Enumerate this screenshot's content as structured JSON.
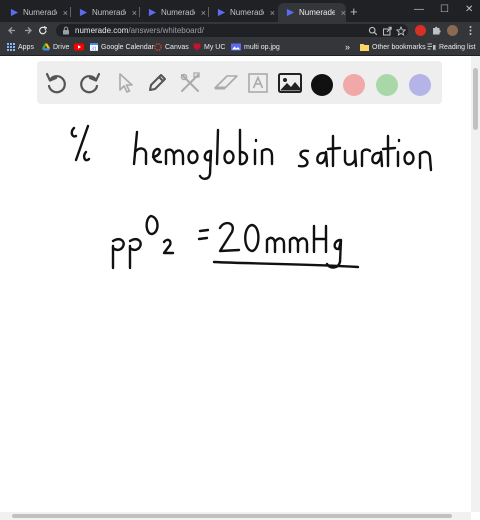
{
  "tabs": [
    {
      "title": "Numerade W"
    },
    {
      "title": "Numerade W"
    },
    {
      "title": "Numerade W"
    },
    {
      "title": "Numerade W"
    },
    {
      "title": "Numerade W",
      "active": true
    }
  ],
  "tab_close_glyph": "×",
  "new_tab_glyph": "+",
  "window_controls": {
    "minimize": "—",
    "maximize": "☐",
    "close": "✕"
  },
  "address": {
    "host": "numerade.com",
    "path": "/answers/whiteboard/"
  },
  "bookmarks": [
    {
      "label": "Apps",
      "icon": "apps-grid-icon"
    },
    {
      "label": "Drive",
      "icon": "google-drive-icon"
    },
    {
      "label": "",
      "icon": "youtube-icon"
    },
    {
      "label": "Google Calendar",
      "icon": "google-calendar-icon"
    },
    {
      "label": "Canvas",
      "icon": "canvas-icon"
    },
    {
      "label": "My UC",
      "icon": "my-uc-icon"
    },
    {
      "label": "multi op.jpg",
      "icon": "image-file-icon"
    }
  ],
  "bookmarks_overflow": "»",
  "other_bookmarks": "Other bookmarks",
  "reading_list": "Reading list",
  "whiteboard": {
    "tools": [
      "undo-icon",
      "redo-icon",
      "pointer-icon",
      "pen-icon",
      "tools-icon",
      "eraser-icon",
      "text-icon",
      "image-icon"
    ],
    "colors": [
      "#111111",
      "#f0a8a8",
      "#a9d8a8",
      "#b4b4e8"
    ],
    "handwriting": [
      "% hemoglobin saturation",
      "ppO2 = 20mmHg"
    ]
  },
  "colors": {
    "chrome_dark": "#202124",
    "chrome_mid": "#35363a",
    "favicon_blue": "#5b6cf0"
  }
}
